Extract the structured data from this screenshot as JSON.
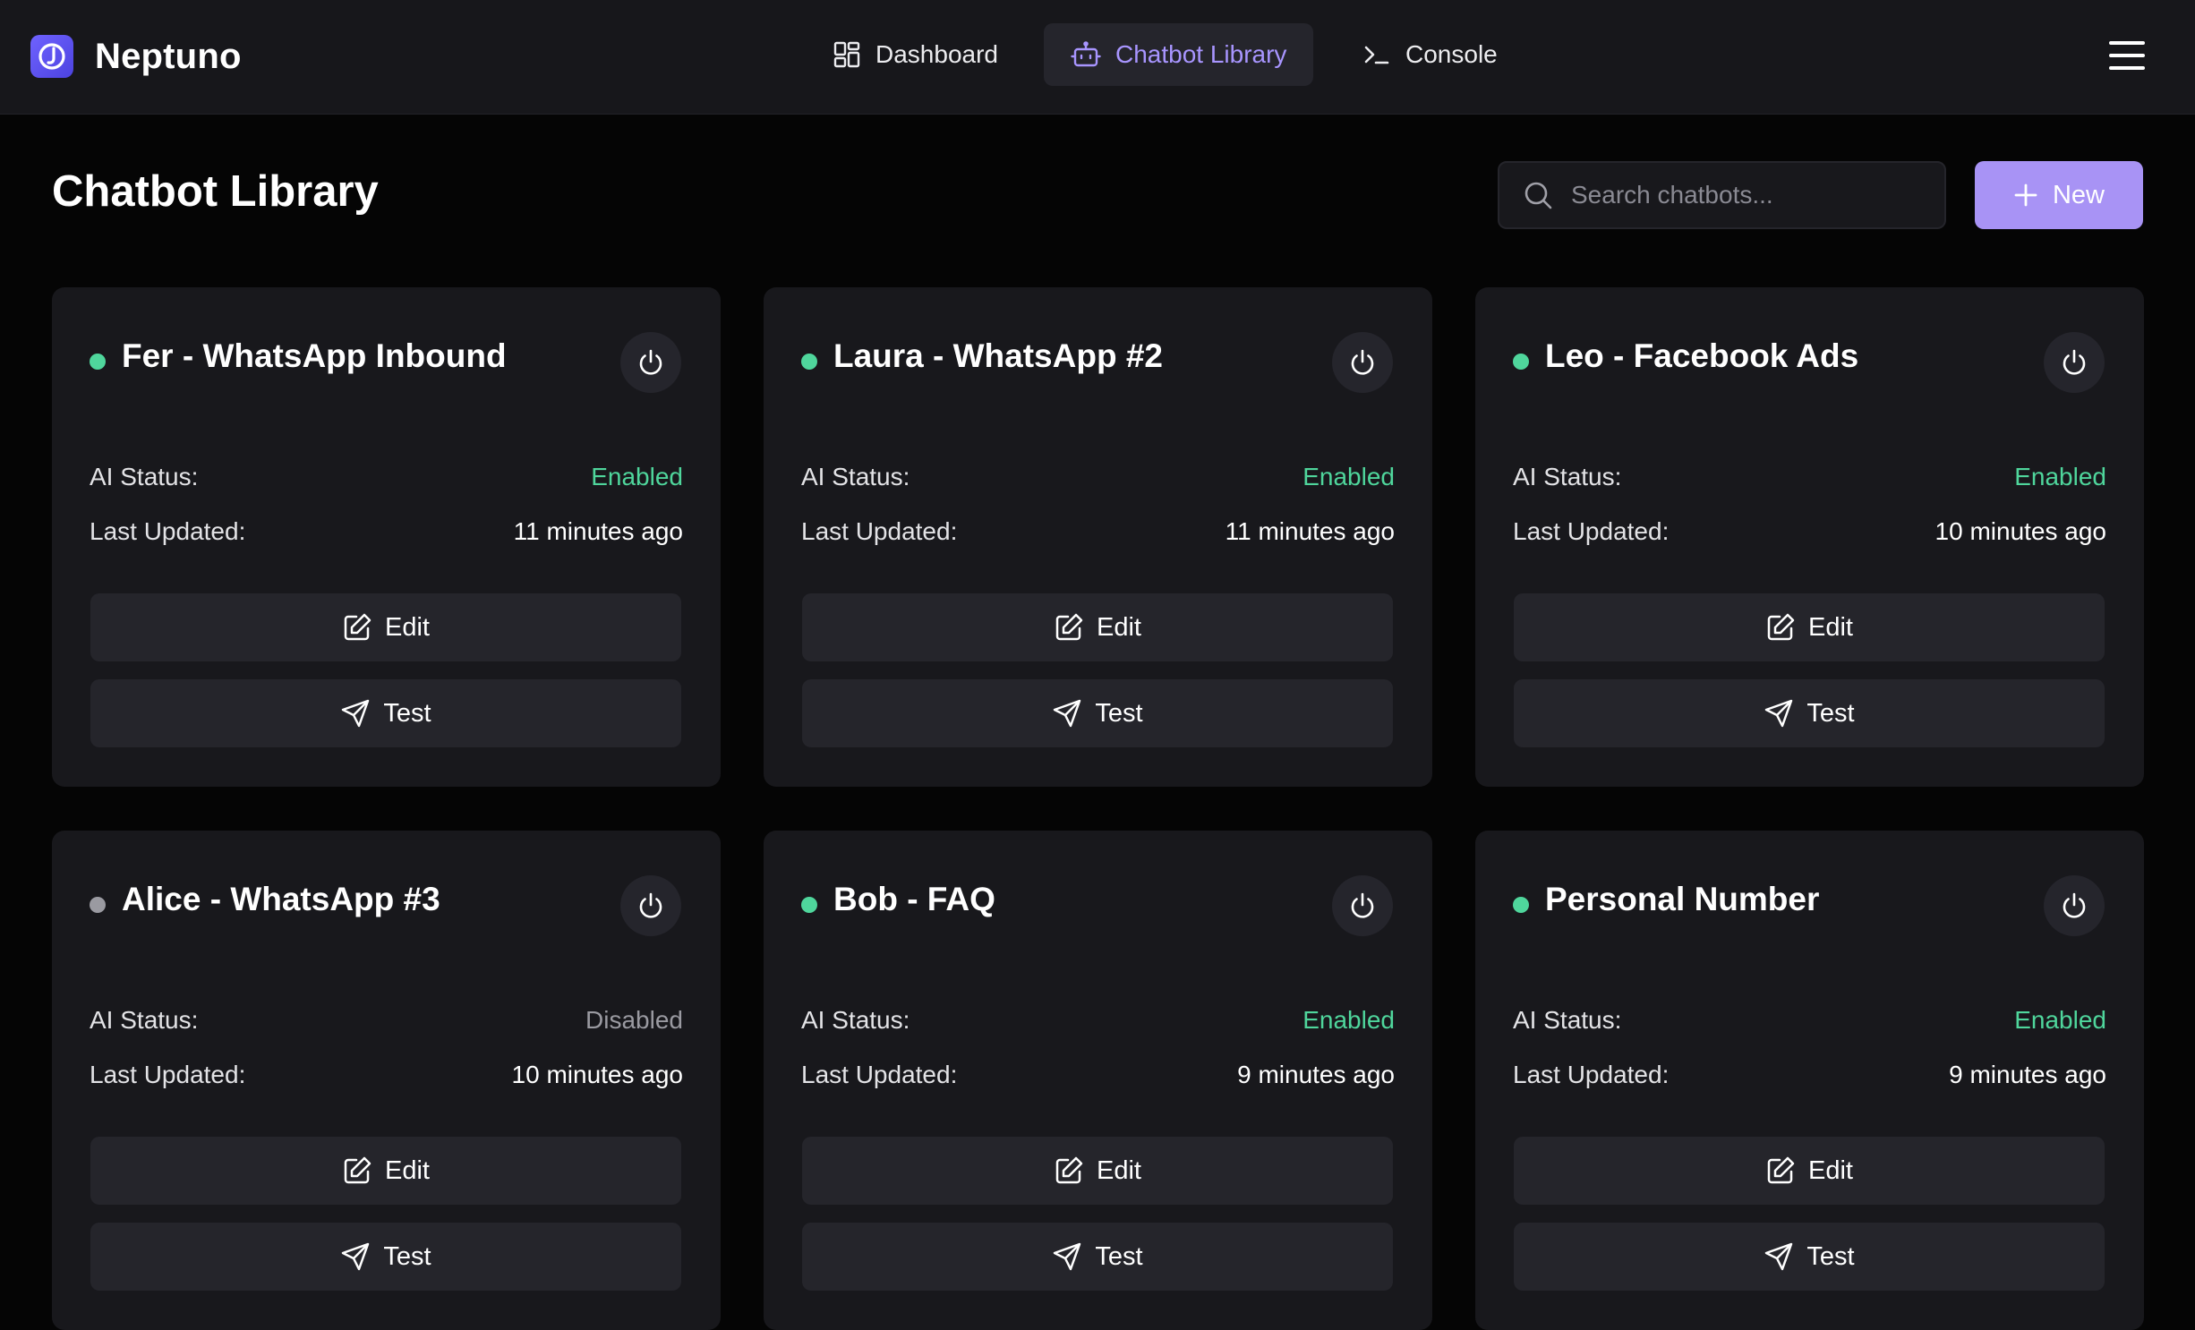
{
  "app": {
    "name": "Neptuno",
    "accent_color": "#a893f5",
    "status_on_color": "#4fd69c",
    "status_off_color": "#9a9aa1"
  },
  "nav": {
    "items": [
      {
        "label": "Dashboard",
        "icon": "dashboard-grid-icon",
        "active": false
      },
      {
        "label": "Chatbot Library",
        "icon": "bot-icon",
        "active": true
      },
      {
        "label": "Console",
        "icon": "terminal-icon",
        "active": false
      }
    ],
    "menu_icon": "hamburger-menu-icon"
  },
  "header": {
    "title": "Chatbot Library",
    "search_placeholder": "Search chatbots...",
    "new_button_label": "New"
  },
  "labels": {
    "ai_status": "AI Status:",
    "last_updated": "Last Updated:",
    "edit": "Edit",
    "test": "Test"
  },
  "chatbots": [
    {
      "name": "Fer - WhatsApp Inbound",
      "active": true,
      "ai_status": "Enabled",
      "last_updated": "11 minutes ago"
    },
    {
      "name": "Laura - WhatsApp #2",
      "active": true,
      "ai_status": "Enabled",
      "last_updated": "11 minutes ago"
    },
    {
      "name": "Leo - Facebook Ads",
      "active": true,
      "ai_status": "Enabled",
      "last_updated": "10 minutes ago"
    },
    {
      "name": "Alice - WhatsApp #3",
      "active": false,
      "ai_status": "Disabled",
      "last_updated": "10 minutes ago"
    },
    {
      "name": "Bob - FAQ",
      "active": true,
      "ai_status": "Enabled",
      "last_updated": "9 minutes ago"
    },
    {
      "name": "Personal Number",
      "active": true,
      "ai_status": "Enabled",
      "last_updated": "9 minutes ago"
    }
  ]
}
